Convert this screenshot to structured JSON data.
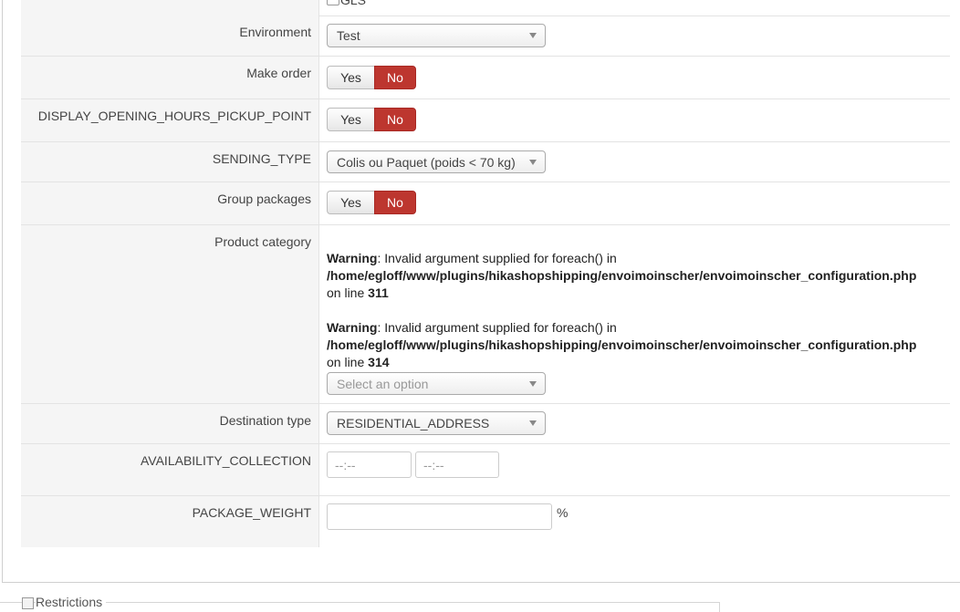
{
  "top_option": {
    "label": "GLS"
  },
  "rows": {
    "environment": {
      "label": "Environment",
      "value": "Test"
    },
    "make_order": {
      "label": "Make order",
      "yes": "Yes",
      "no": "No"
    },
    "display_opening": {
      "label": "DISPLAY_OPENING_HOURS_PICKUP_POINT",
      "yes": "Yes",
      "no": "No"
    },
    "sending_type": {
      "label": "SENDING_TYPE",
      "value": "Colis ou Paquet (poids < 70 kg)"
    },
    "group_packages": {
      "label": "Group packages",
      "yes": "Yes",
      "no": "No"
    },
    "product_category": {
      "label": "Product category",
      "warnings": [
        {
          "bold": "Warning",
          "text": ": Invalid argument supplied for foreach() in",
          "path": "/home/egloff/www/plugins/hikashopshipping/envoimoinscher/envoimoinscher_configuration.php",
          "online": "on line ",
          "line": "311"
        },
        {
          "bold": "Warning",
          "text": ": Invalid argument supplied for foreach() in",
          "path": "/home/egloff/www/plugins/hikashopshipping/envoimoinscher/envoimoinscher_configuration.php",
          "online": "on line ",
          "line": "314"
        }
      ],
      "placeholder": "Select an option"
    },
    "destination_type": {
      "label": "Destination type",
      "value": "RESIDENTIAL_ADDRESS"
    },
    "availability": {
      "label": "AVAILABILITY_COLLECTION",
      "from_placeholder": "--:--",
      "to_placeholder": "--:--"
    },
    "package_weight": {
      "label": "PACKAGE_WEIGHT",
      "value": "",
      "unit": "%"
    }
  },
  "restrictions": {
    "label": "Restrictions"
  },
  "colors": {
    "no_active": "#bd362f",
    "label_bg": "#f5f5f5"
  }
}
